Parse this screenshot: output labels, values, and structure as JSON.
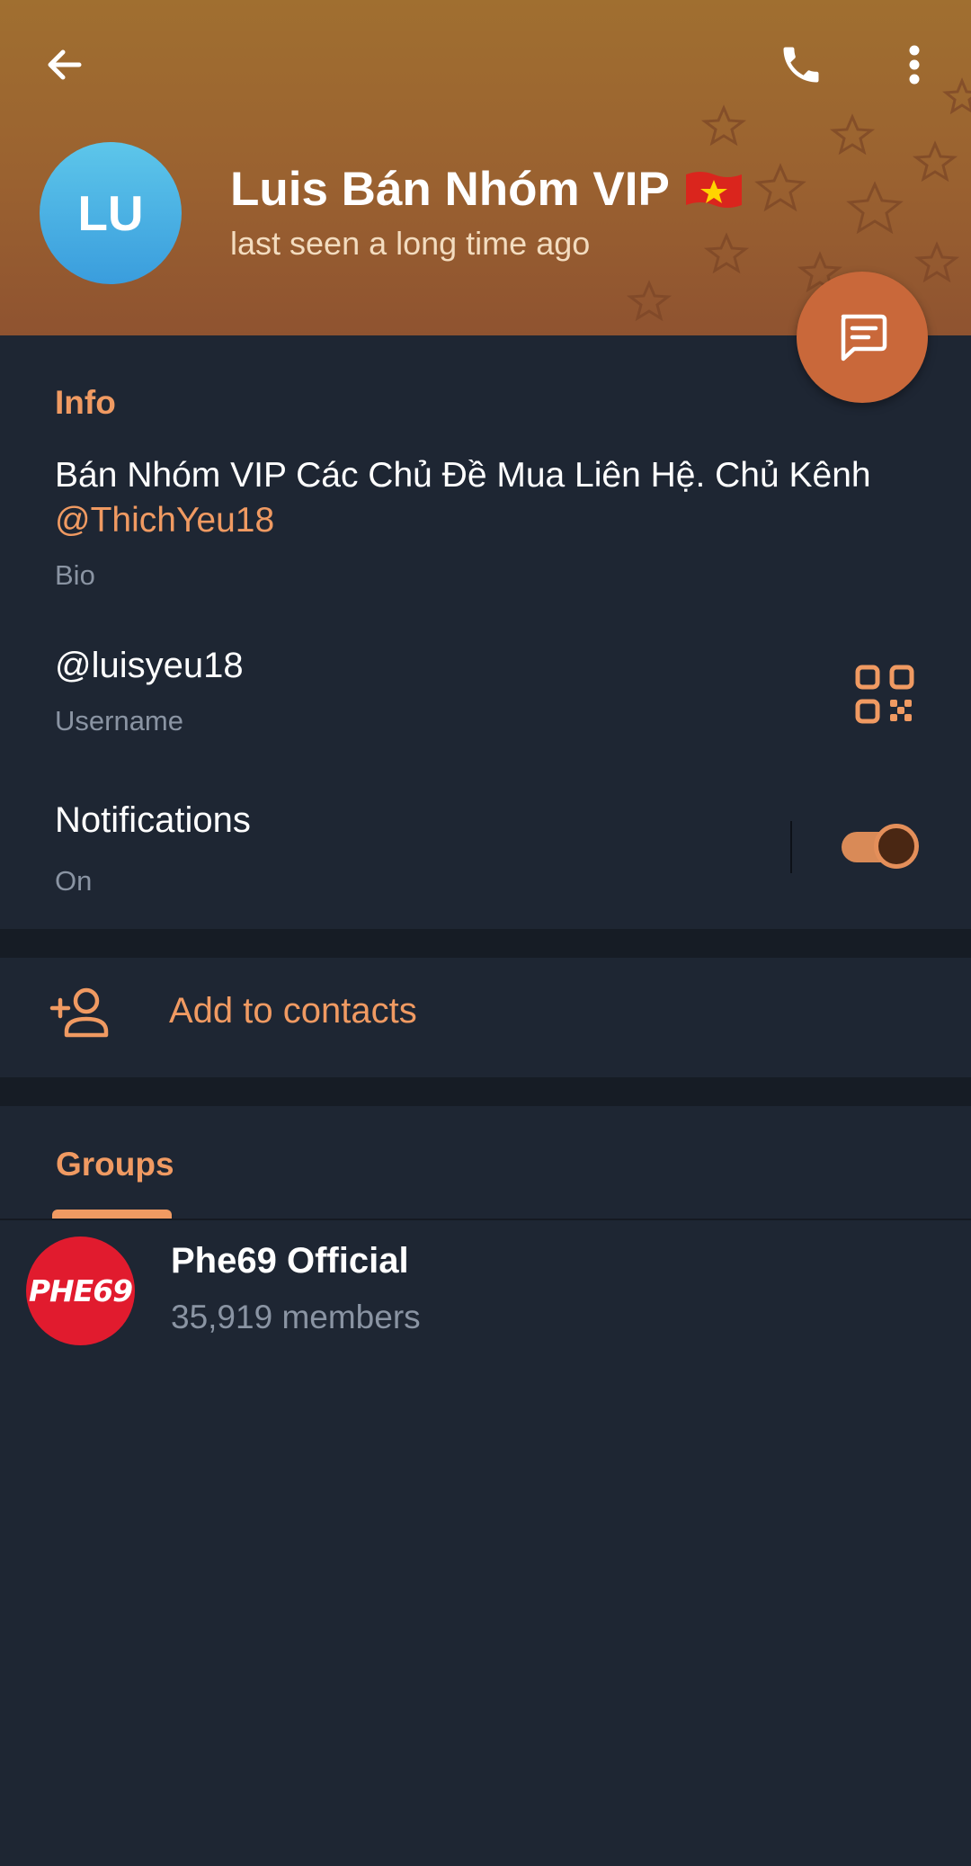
{
  "colors": {
    "accent": "#f09a62",
    "background": "#1e2633",
    "header_gradient_top": "#a06f30",
    "header_gradient_bottom": "#8f5330",
    "avatar_blue": "#3a9ddd",
    "fab": "#c9683a",
    "group_avatar_red": "#e11b2e"
  },
  "header": {
    "back_icon": "arrow-left-icon",
    "call_icon": "phone-icon",
    "more_icon": "more-vertical-icon",
    "avatar_initials": "LU",
    "name": "Luis Bán Nhóm VIP",
    "flag_icon": "vietnam-flag-icon",
    "status": "last seen a long time ago",
    "fab_icon": "message-icon"
  },
  "info": {
    "section_title": "Info",
    "bio_text": "Bán Nhóm VIP Các Chủ Đề Mua Liên Hệ. Chủ Kênh",
    "bio_mention": "@ThichYeu18",
    "bio_label": "Bio",
    "username": "@luisyeu18",
    "username_label": "Username",
    "qr_icon": "qr-code-icon",
    "notifications_title": "Notifications",
    "notifications_status": "On",
    "notifications_enabled": true
  },
  "contacts": {
    "icon": "add-user-icon",
    "label": "Add to contacts"
  },
  "groups": {
    "tab_label": "Groups",
    "items": [
      {
        "name": "Phe69 Official",
        "members": "35,919 members",
        "avatar_text": "PHE69"
      }
    ]
  }
}
